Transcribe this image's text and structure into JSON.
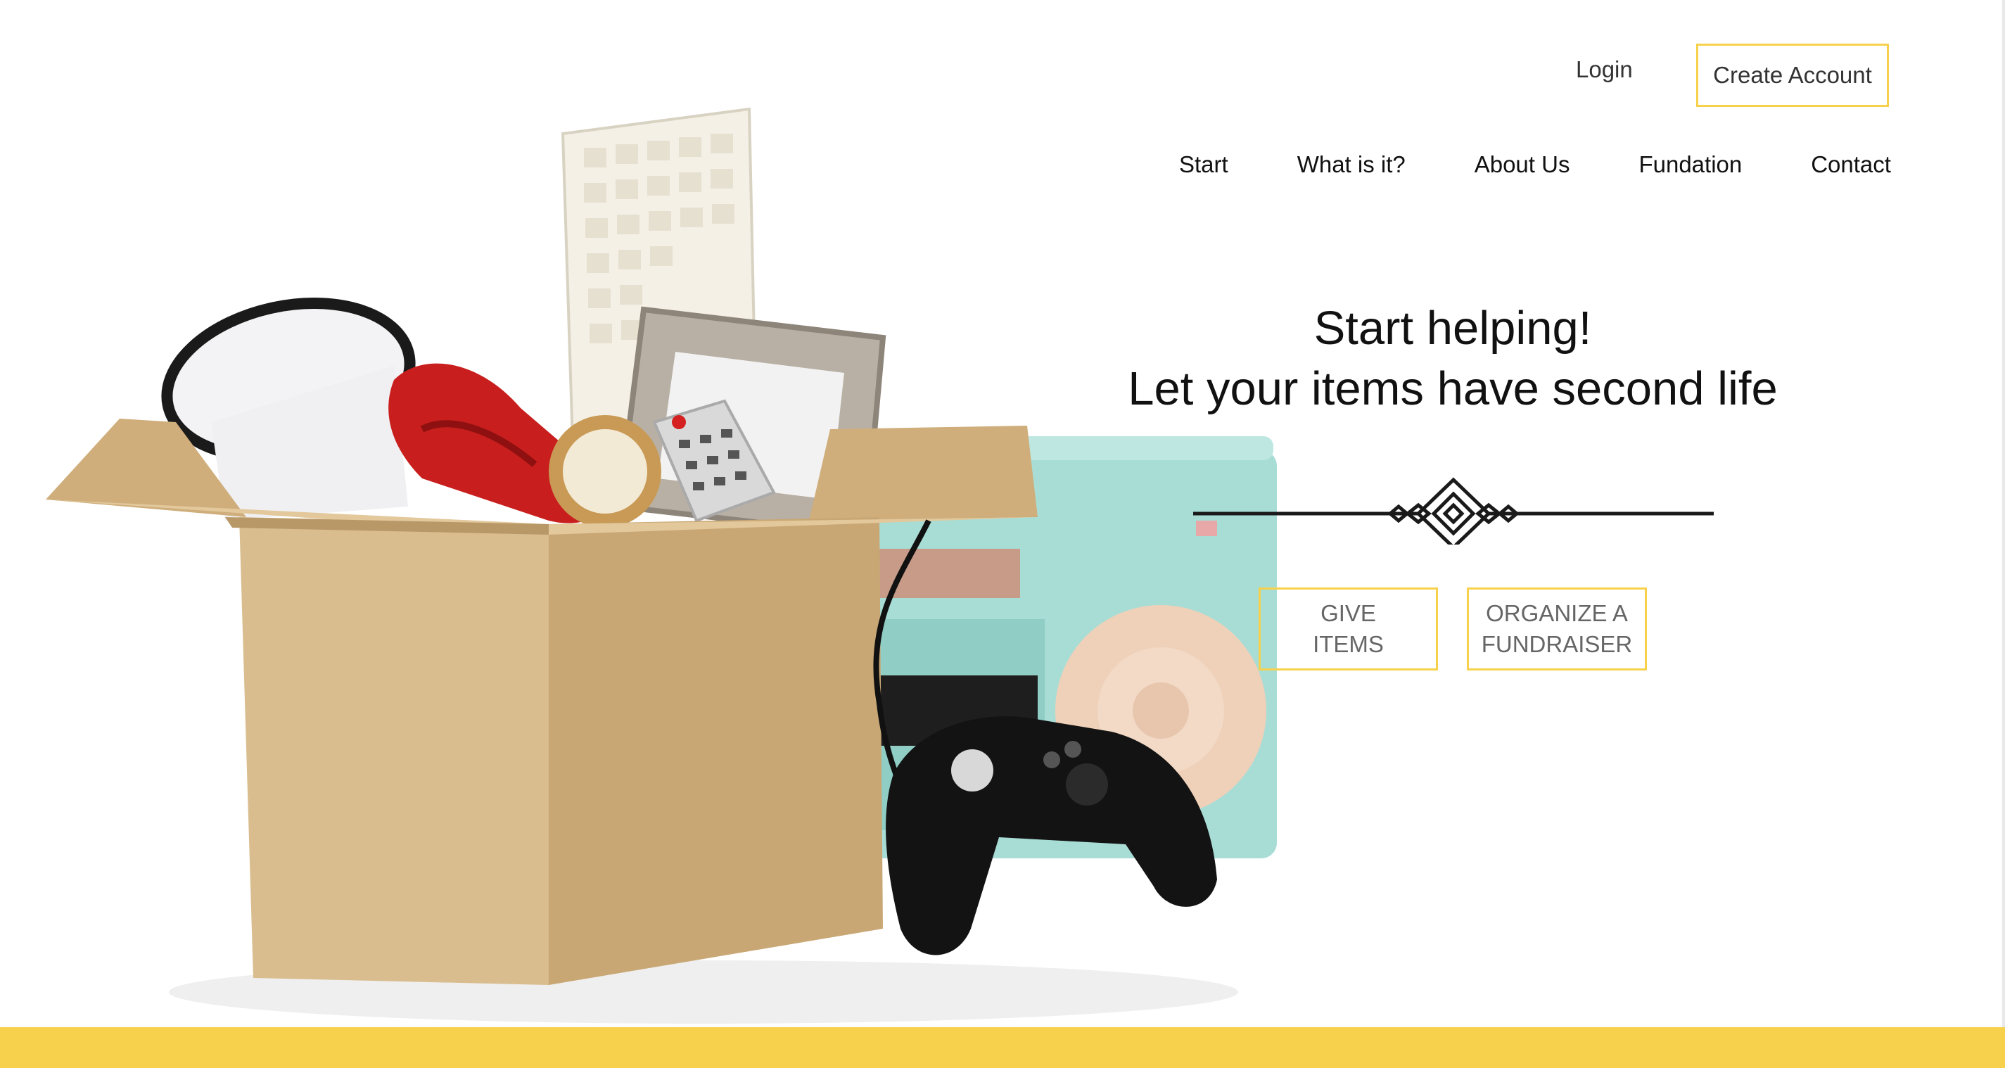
{
  "colors": {
    "accent": "#f7d14c",
    "text": "#111111",
    "muted_text": "#666666",
    "box": "#d9bd8e",
    "box_dark": "#b99868",
    "radio": "#a8ddd6",
    "phone": "#c81e1e"
  },
  "auth": {
    "login_label": "Login",
    "create_account_label": "Create Account"
  },
  "nav": {
    "items": [
      "Start",
      "What is it?",
      "About Us",
      "Fundation",
      "Contact"
    ]
  },
  "hero": {
    "title_line1": "Start helping!",
    "title_line2": "Let your items have second life",
    "divider_icon": "ornament-divider-icon"
  },
  "cta": {
    "give_line1": "GIVE",
    "give_line2": "ITEMS",
    "organize_line1": "ORGANIZE A",
    "organize_line2": "FUNDRAISER"
  },
  "image": {
    "subject": "hero-image-box-of-items",
    "items": [
      "cardboard-box",
      "keyboard",
      "megaphone",
      "telephone",
      "picture-frame",
      "clock",
      "remote-control",
      "game-controller",
      "retro-radio"
    ]
  }
}
